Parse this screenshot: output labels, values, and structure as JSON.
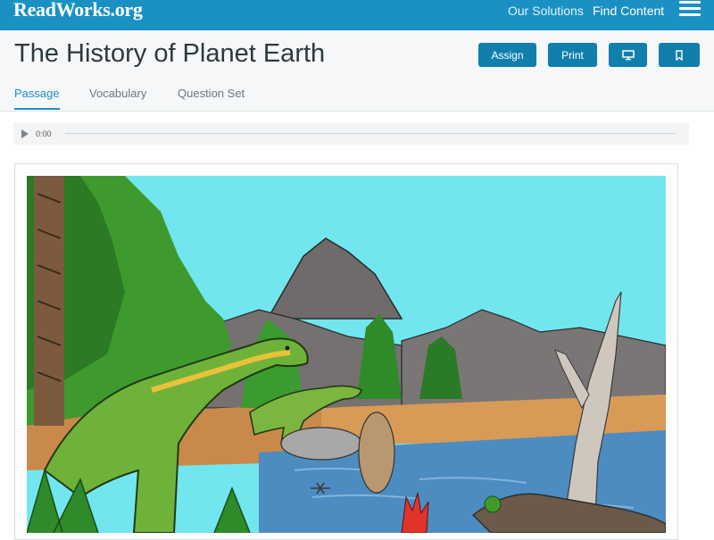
{
  "topbar": {
    "logo": "ReadWorks.org",
    "nav": {
      "solutions": "Our Solutions",
      "find_content": "Find Content"
    },
    "menu_icon": "hamburger-menu-icon"
  },
  "header": {
    "title": "The History of Planet Earth",
    "buttons": {
      "assign": "Assign",
      "print": "Print",
      "display_icon": "monitor-icon",
      "bookmark_icon": "bookmark-icon"
    },
    "tabs": [
      "Passage",
      "Vocabulary",
      "Question Set"
    ],
    "active_tab": "Passage"
  },
  "audio": {
    "time": "0:00",
    "play_icon": "play-icon"
  },
  "colors": {
    "brand": "#1a91c2",
    "button": "#117fac",
    "sky": "#72e6ee",
    "water": "#4d8cc0"
  }
}
